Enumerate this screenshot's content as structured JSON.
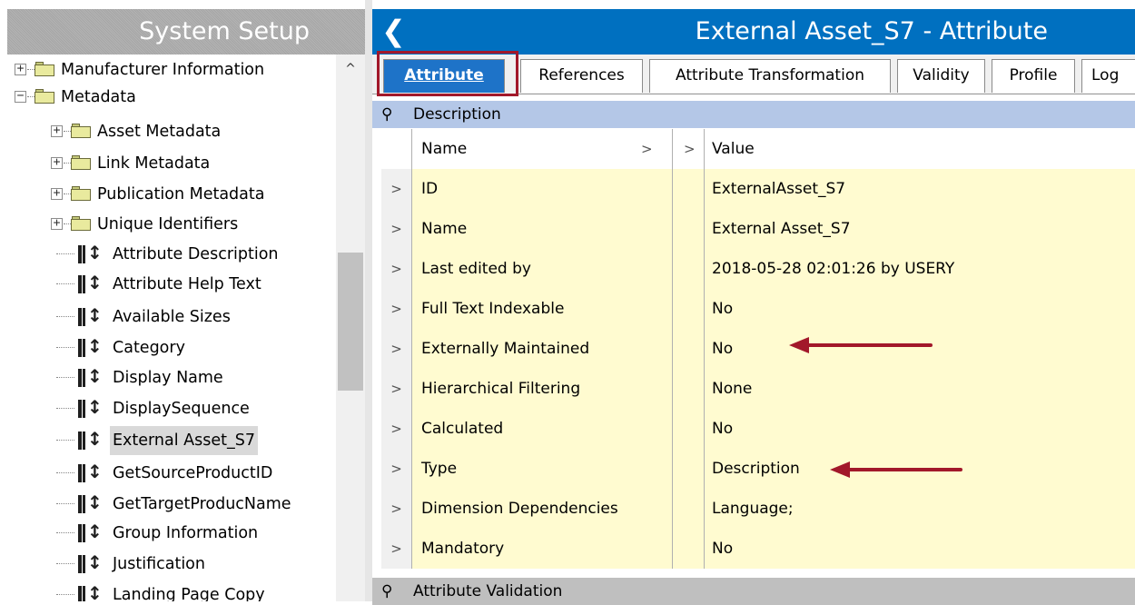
{
  "left_pane": {
    "title": "System Setup",
    "tree": [
      {
        "label": "Manufacturer Information",
        "type": "folder",
        "expander": "+"
      },
      {
        "label": "Metadata",
        "type": "folder",
        "expander": "−"
      },
      {
        "label": "Asset Metadata",
        "type": "folder",
        "expander": "+"
      },
      {
        "label": "Link Metadata",
        "type": "folder",
        "expander": "+"
      },
      {
        "label": "Publication Metadata",
        "type": "folder",
        "expander": "+"
      },
      {
        "label": "Unique Identifiers",
        "type": "folder",
        "expander": "+"
      },
      {
        "label": "Attribute Description",
        "type": "attribute"
      },
      {
        "label": "Attribute Help Text",
        "type": "attribute"
      },
      {
        "label": "Available Sizes",
        "type": "attribute"
      },
      {
        "label": "Category",
        "type": "attribute"
      },
      {
        "label": "Display Name",
        "type": "attribute"
      },
      {
        "label": "DisplaySequence",
        "type": "attribute"
      },
      {
        "label": "External Asset_S7",
        "type": "attribute",
        "selected": true
      },
      {
        "label": "GetSourceProductID",
        "type": "attribute"
      },
      {
        "label": "GetTargetProducName",
        "type": "attribute"
      },
      {
        "label": "Group Information",
        "type": "attribute"
      },
      {
        "label": "Justification",
        "type": "attribute"
      },
      {
        "label": "Landing Page Copy",
        "type": "attribute"
      }
    ]
  },
  "editor": {
    "back_icon": "chevron-left-icon",
    "title": "External Asset_S7 - Attribute",
    "tabs": [
      "Attribute",
      "References",
      "Attribute Transformation",
      "Validity",
      "Profile",
      "Log"
    ],
    "active_tab": "Attribute"
  },
  "description_section": {
    "label": "Description",
    "header": {
      "name": "Name",
      "value": "Value"
    },
    "rows": [
      {
        "name": "ID",
        "value": "ExternalAsset_S7"
      },
      {
        "name": "Name",
        "value": "External Asset_S7"
      },
      {
        "name": "Last edited by",
        "value": "2018-05-28 02:01:26 by USERY"
      },
      {
        "name": "Full Text Indexable",
        "value": "No"
      },
      {
        "name": "Externally Maintained",
        "value": "No"
      },
      {
        "name": "Hierarchical Filtering",
        "value": "None"
      },
      {
        "name": "Calculated",
        "value": "No"
      },
      {
        "name": "Type",
        "value": "Description"
      },
      {
        "name": "Dimension Dependencies",
        "value": "Language;"
      },
      {
        "name": "Mandatory",
        "value": "No"
      }
    ]
  },
  "validation_section": {
    "label": "Attribute Validation"
  },
  "colors": {
    "header_blue": "#0070c0",
    "active_tab": "#1e73c8",
    "section_blue": "#b4c7e7",
    "cell_yellow": "#fffbd0",
    "annotation_red": "#a2182a"
  }
}
